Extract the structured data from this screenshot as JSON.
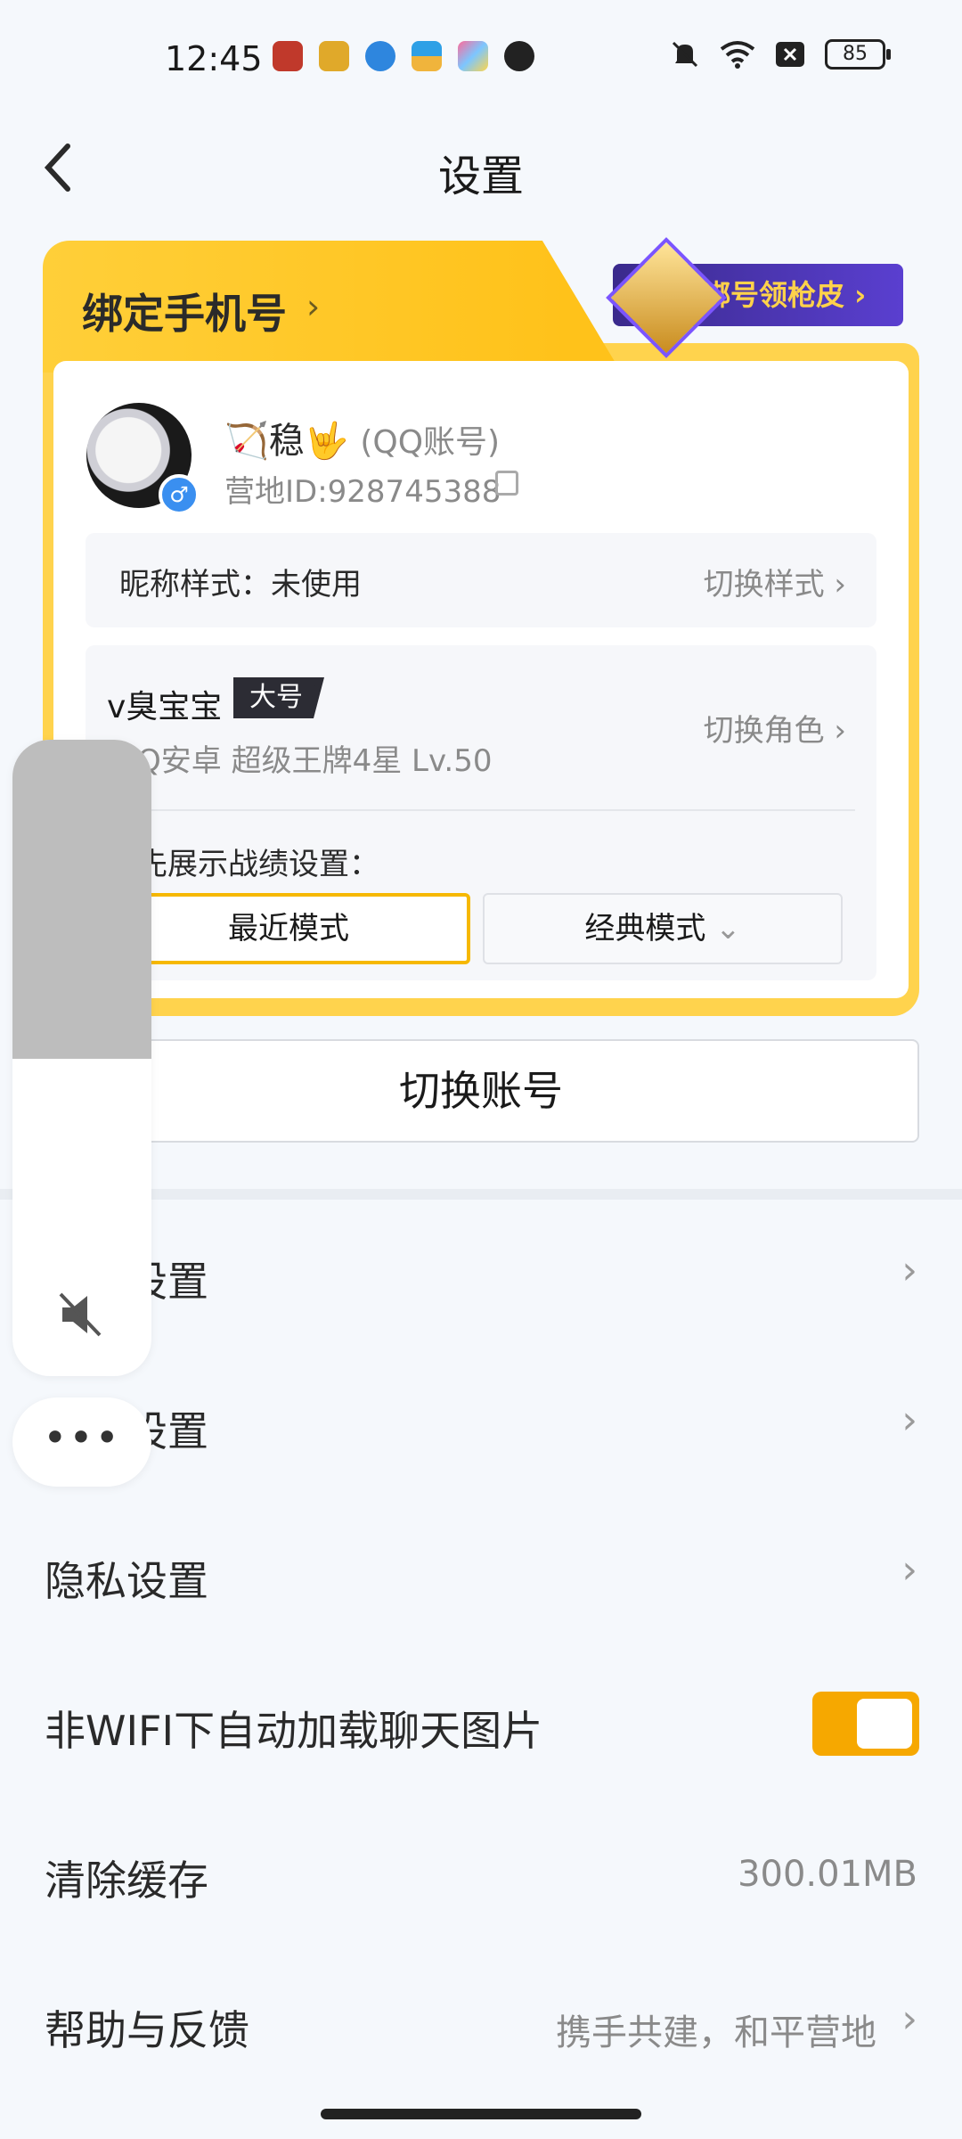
{
  "status_bar": {
    "time": "12:45",
    "app_icons": [
      "game-icon-1",
      "game-icon-2",
      "app-icon-3",
      "app-icon-4",
      "app-icon-5",
      "app-icon-6"
    ],
    "icons": [
      "mute-icon",
      "wifi-icon",
      "close-box-icon"
    ],
    "battery": "85"
  },
  "nav": {
    "title": "设置",
    "back_icon": "back-arrow-icon"
  },
  "account_card": {
    "bind_phone": "绑定手机号",
    "bind_chevron": "›",
    "promo_label": "绑号领枪皮",
    "promo_chevron": "›",
    "nickname": "🏹稳🤟",
    "account_type": "(QQ账号)",
    "camp_id": "营地ID:928745388",
    "gender_symbol": "♂",
    "nickname_style_label": "昵称样式：未使用",
    "switch_style": "切换样式",
    "role": {
      "name": "v臭宝宝",
      "tag": "大号",
      "info": "手Q安卓  超级王牌4星  Lv.50",
      "switch_role": "切换角色"
    },
    "record_label": "优先展示战绩设置：",
    "modes": {
      "recent": "最近模式",
      "classic": "经典模式",
      "classic_arrow": "⌄"
    }
  },
  "switch_account": "切换账号",
  "settings": [
    {
      "label": "消息设置",
      "chevron": "›"
    },
    {
      "label": "通用设置",
      "chevron": "›"
    },
    {
      "label": "隐私设置",
      "chevron": "›"
    },
    {
      "label": "非WIFI下自动加载聊天图片",
      "toggle_on": true
    },
    {
      "label": "清除缓存",
      "value": "300.01MB"
    },
    {
      "label": "帮助与反馈",
      "value": "携手共建，和平营地",
      "chevron": "›"
    }
  ],
  "volume_overlay": {
    "level": 0.5,
    "icon": "speaker-mute-icon",
    "more": "•••"
  },
  "colors": {
    "accent": "#f6a800",
    "card_yellow": "#ffcf39",
    "background": "#f5f8fc"
  }
}
